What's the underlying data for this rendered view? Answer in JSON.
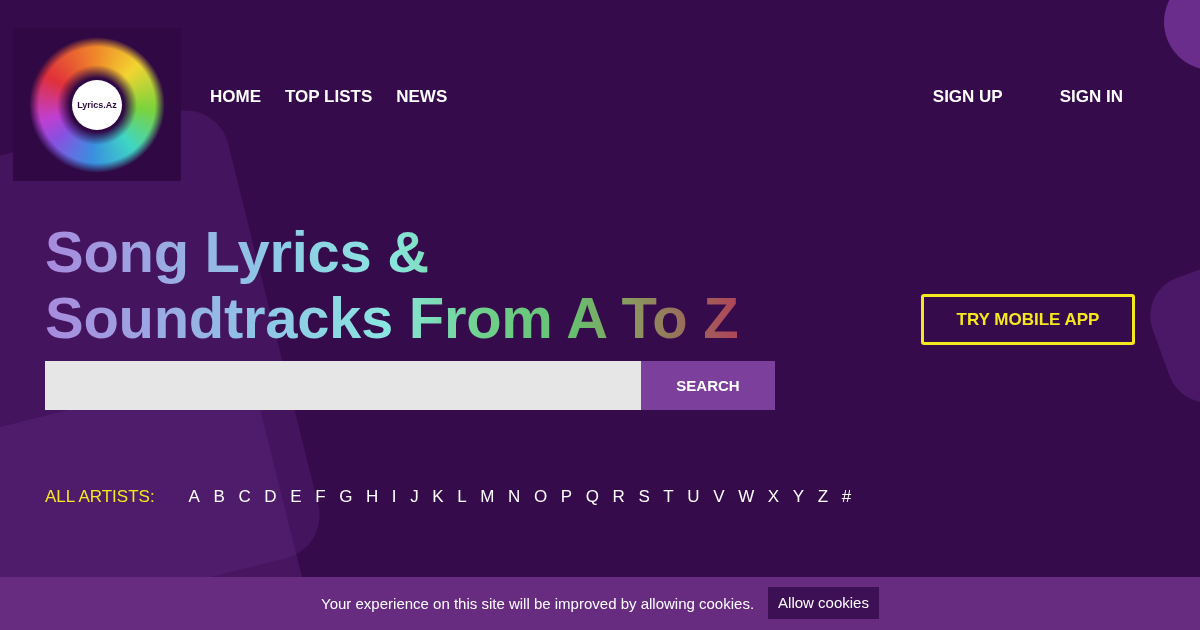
{
  "logo": {
    "text": "Lyrics.Az"
  },
  "nav": {
    "links": [
      "HOME",
      "TOP LISTS",
      "NEWS"
    ],
    "account_links": [
      "SIGN UP",
      "SIGN IN"
    ]
  },
  "hero": {
    "headline": "Song Lyrics & Soundtracks From A To Z",
    "search": {
      "button": "SEARCH"
    },
    "mobile_app_button": "TRY MOBILE APP"
  },
  "artists_index": {
    "label": "ALL ARTISTS:",
    "letters": [
      "A",
      "B",
      "C",
      "D",
      "E",
      "F",
      "G",
      "H",
      "I",
      "J",
      "K",
      "L",
      "M",
      "N",
      "O",
      "P",
      "Q",
      "R",
      "S",
      "T",
      "U",
      "V",
      "W",
      "X",
      "Y",
      "Z",
      "#"
    ]
  },
  "cookie_banner": {
    "message": "Your experience on this site will be improved by allowing cookies.",
    "button": "Allow cookies"
  }
}
